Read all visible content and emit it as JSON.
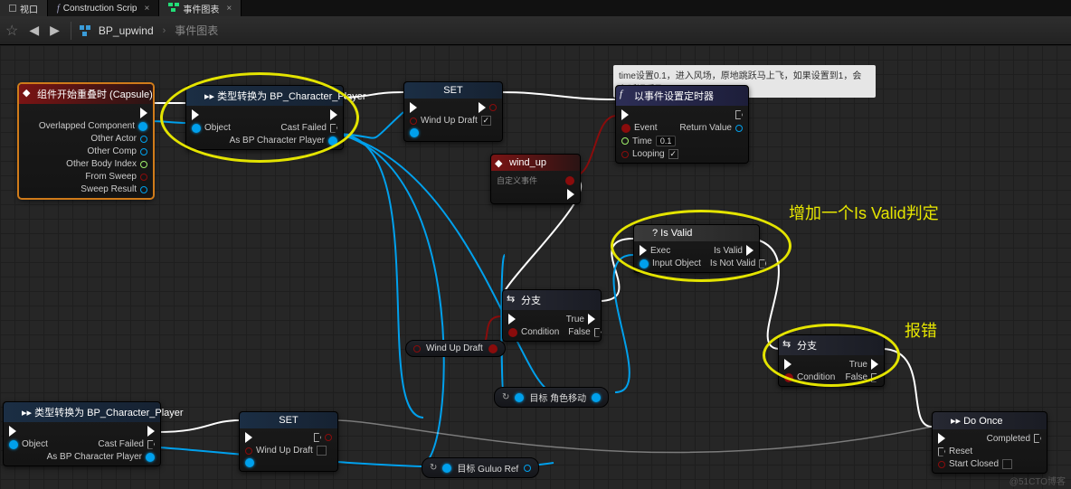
{
  "tabs": {
    "viewport": "视口",
    "construction": "Construction Scrip",
    "eventGraph": "事件图表"
  },
  "toolbar": {
    "blueprint": "BP_upwind",
    "sub": "事件图表"
  },
  "comment": "time设置0.1，进入风场，原地跳跃马上飞，如果设置到1，会有延迟后飞",
  "n_event": {
    "title": "组件开始重叠时 (Capsule)",
    "p_overlap": "Overlapped Component",
    "p_other": "Other Actor",
    "p_comp": "Other Comp",
    "p_body": "Other Body Index",
    "p_sweep": "From Sweep",
    "p_result": "Sweep Result"
  },
  "n_cast1": {
    "title": "▸▸ 类型转换为 BP_Character_Player",
    "object": "Object",
    "failed": "Cast Failed",
    "as": "As BP Character Player"
  },
  "n_set": {
    "title": "SET",
    "wind": "Wind Up Draft"
  },
  "n_wind": {
    "title": "wind_up",
    "sub": "自定义事件"
  },
  "n_timer": {
    "title": "以事件设置定时器",
    "event": "Event",
    "time": "Time",
    "timeval": "0.1",
    "looping": "Looping",
    "return": "Return Value"
  },
  "n_valid": {
    "title": "? Is Valid",
    "exec": "Exec",
    "input": "Input Object",
    "isv": "Is Valid",
    "isnv": "Is Not Valid"
  },
  "n_branch": {
    "title": "分支",
    "cond": "Condition",
    "true": "True",
    "false": "False"
  },
  "n_cast2": {
    "title": "▸▸ 类型转换为 BP_Character_Player",
    "object": "Object",
    "failed": "Cast Failed",
    "as": "As BP Character Player"
  },
  "n_set2": {
    "title": "SET",
    "wind": "Wind Up Draft"
  },
  "n_doonce": {
    "title": "▸▸ Do Once",
    "reset": "Reset",
    "start": "Start Closed",
    "completed": "Completed"
  },
  "mini": {
    "windup": "Wind Up Draft",
    "move": "目标    角色移动",
    "guluo": "目标    Guluo Ref"
  },
  "anno": {
    "valid": "增加一个Is Valid判定",
    "err": "报错"
  },
  "watermark": "@51CTO博客"
}
